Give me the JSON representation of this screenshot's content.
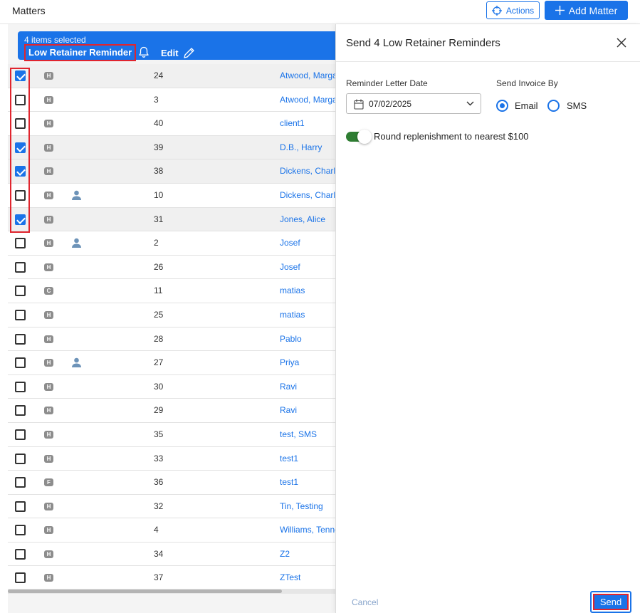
{
  "header": {
    "title": "Matters",
    "actions_label": "Actions",
    "add_matter_label": "Add Matter"
  },
  "selection_bar": {
    "count_text": "4 items selected",
    "low_retainer_label": "Low Retainer Reminder",
    "edit_label": "Edit"
  },
  "rows": [
    {
      "checked": true,
      "badge": "H",
      "person": false,
      "number": "24",
      "client": "Atwood, Margaret"
    },
    {
      "checked": false,
      "badge": "H",
      "person": false,
      "number": "3",
      "client": "Atwood, Margaret"
    },
    {
      "checked": false,
      "badge": "H",
      "person": false,
      "number": "40",
      "client": "client1"
    },
    {
      "checked": true,
      "badge": "H",
      "person": false,
      "number": "39",
      "client": "D.B., Harry"
    },
    {
      "checked": true,
      "badge": "H",
      "person": false,
      "number": "38",
      "client": "Dickens, Charles"
    },
    {
      "checked": false,
      "badge": "H",
      "person": true,
      "number": "10",
      "client": "Dickens, Charles"
    },
    {
      "checked": true,
      "badge": "H",
      "person": false,
      "number": "31",
      "client": "Jones, Alice"
    },
    {
      "checked": false,
      "badge": "H",
      "person": true,
      "number": "2",
      "client": "Josef"
    },
    {
      "checked": false,
      "badge": "H",
      "person": false,
      "number": "26",
      "client": "Josef"
    },
    {
      "checked": false,
      "badge": "C",
      "person": false,
      "number": "11",
      "client": "matias"
    },
    {
      "checked": false,
      "badge": "H",
      "person": false,
      "number": "25",
      "client": "matias"
    },
    {
      "checked": false,
      "badge": "H",
      "person": false,
      "number": "28",
      "client": "Pablo"
    },
    {
      "checked": false,
      "badge": "H",
      "person": true,
      "number": "27",
      "client": "Priya"
    },
    {
      "checked": false,
      "badge": "H",
      "person": false,
      "number": "30",
      "client": "Ravi"
    },
    {
      "checked": false,
      "badge": "H",
      "person": false,
      "number": "29",
      "client": "Ravi"
    },
    {
      "checked": false,
      "badge": "H",
      "person": false,
      "number": "35",
      "client": "test, SMS"
    },
    {
      "checked": false,
      "badge": "H",
      "person": false,
      "number": "33",
      "client": "test1"
    },
    {
      "checked": false,
      "badge": "F",
      "person": false,
      "number": "36",
      "client": "test1"
    },
    {
      "checked": false,
      "badge": "H",
      "person": false,
      "number": "32",
      "client": "Tin, Testing"
    },
    {
      "checked": false,
      "badge": "H",
      "person": false,
      "number": "4",
      "client": "Williams, Tennessee"
    },
    {
      "checked": false,
      "badge": "H",
      "person": false,
      "number": "34",
      "client": "Z2"
    },
    {
      "checked": false,
      "badge": "H",
      "person": false,
      "number": "37",
      "client": "ZTest"
    }
  ],
  "panel": {
    "title": "Send 4 Low Retainer Reminders",
    "reminder_date_label": "Reminder Letter Date",
    "reminder_date_value": "07/02/2025",
    "send_invoice_label": "Send Invoice By",
    "option_email": "Email",
    "option_sms": "SMS",
    "selected_option": "Email",
    "round_toggle_label": "Round replenishment to nearest $100",
    "round_toggle_on": true,
    "cancel_label": "Cancel",
    "send_label": "Send"
  },
  "colors": {
    "primary": "#1a73e8",
    "highlight": "#e0252e",
    "toggle_on": "#2e7d32"
  },
  "icons": {
    "actions": "crosshair-icon",
    "add": "plus-icon",
    "bell": "bell-icon",
    "edit": "pencil-icon",
    "close": "close-icon",
    "calendar": "calendar-icon",
    "chevron": "chevron-down-icon",
    "person": "person-icon"
  }
}
